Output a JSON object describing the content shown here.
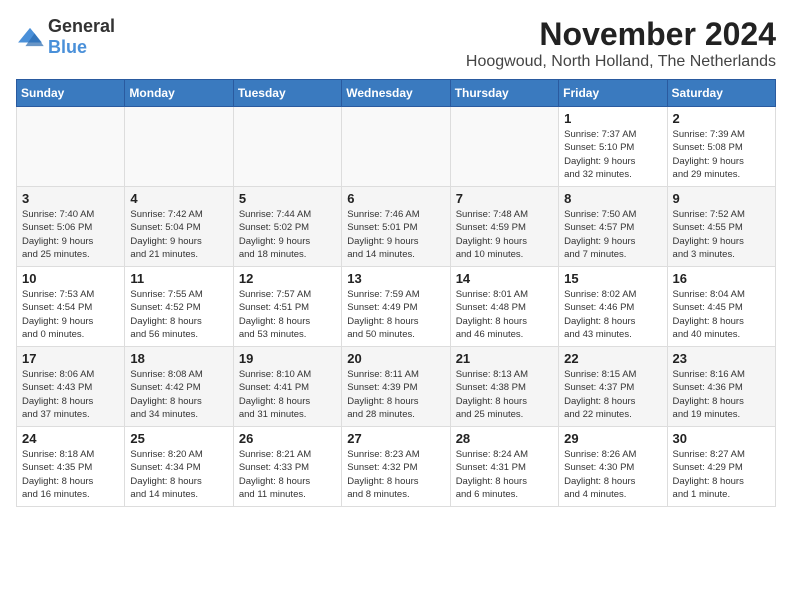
{
  "logo": {
    "general": "General",
    "blue": "Blue"
  },
  "title": "November 2024",
  "subtitle": "Hoogwoud, North Holland, The Netherlands",
  "days_header": [
    "Sunday",
    "Monday",
    "Tuesday",
    "Wednesday",
    "Thursday",
    "Friday",
    "Saturday"
  ],
  "weeks": [
    [
      {
        "day": "",
        "info": ""
      },
      {
        "day": "",
        "info": ""
      },
      {
        "day": "",
        "info": ""
      },
      {
        "day": "",
        "info": ""
      },
      {
        "day": "",
        "info": ""
      },
      {
        "day": "1",
        "info": "Sunrise: 7:37 AM\nSunset: 5:10 PM\nDaylight: 9 hours\nand 32 minutes."
      },
      {
        "day": "2",
        "info": "Sunrise: 7:39 AM\nSunset: 5:08 PM\nDaylight: 9 hours\nand 29 minutes."
      }
    ],
    [
      {
        "day": "3",
        "info": "Sunrise: 7:40 AM\nSunset: 5:06 PM\nDaylight: 9 hours\nand 25 minutes."
      },
      {
        "day": "4",
        "info": "Sunrise: 7:42 AM\nSunset: 5:04 PM\nDaylight: 9 hours\nand 21 minutes."
      },
      {
        "day": "5",
        "info": "Sunrise: 7:44 AM\nSunset: 5:02 PM\nDaylight: 9 hours\nand 18 minutes."
      },
      {
        "day": "6",
        "info": "Sunrise: 7:46 AM\nSunset: 5:01 PM\nDaylight: 9 hours\nand 14 minutes."
      },
      {
        "day": "7",
        "info": "Sunrise: 7:48 AM\nSunset: 4:59 PM\nDaylight: 9 hours\nand 10 minutes."
      },
      {
        "day": "8",
        "info": "Sunrise: 7:50 AM\nSunset: 4:57 PM\nDaylight: 9 hours\nand 7 minutes."
      },
      {
        "day": "9",
        "info": "Sunrise: 7:52 AM\nSunset: 4:55 PM\nDaylight: 9 hours\nand 3 minutes."
      }
    ],
    [
      {
        "day": "10",
        "info": "Sunrise: 7:53 AM\nSunset: 4:54 PM\nDaylight: 9 hours\nand 0 minutes."
      },
      {
        "day": "11",
        "info": "Sunrise: 7:55 AM\nSunset: 4:52 PM\nDaylight: 8 hours\nand 56 minutes."
      },
      {
        "day": "12",
        "info": "Sunrise: 7:57 AM\nSunset: 4:51 PM\nDaylight: 8 hours\nand 53 minutes."
      },
      {
        "day": "13",
        "info": "Sunrise: 7:59 AM\nSunset: 4:49 PM\nDaylight: 8 hours\nand 50 minutes."
      },
      {
        "day": "14",
        "info": "Sunrise: 8:01 AM\nSunset: 4:48 PM\nDaylight: 8 hours\nand 46 minutes."
      },
      {
        "day": "15",
        "info": "Sunrise: 8:02 AM\nSunset: 4:46 PM\nDaylight: 8 hours\nand 43 minutes."
      },
      {
        "day": "16",
        "info": "Sunrise: 8:04 AM\nSunset: 4:45 PM\nDaylight: 8 hours\nand 40 minutes."
      }
    ],
    [
      {
        "day": "17",
        "info": "Sunrise: 8:06 AM\nSunset: 4:43 PM\nDaylight: 8 hours\nand 37 minutes."
      },
      {
        "day": "18",
        "info": "Sunrise: 8:08 AM\nSunset: 4:42 PM\nDaylight: 8 hours\nand 34 minutes."
      },
      {
        "day": "19",
        "info": "Sunrise: 8:10 AM\nSunset: 4:41 PM\nDaylight: 8 hours\nand 31 minutes."
      },
      {
        "day": "20",
        "info": "Sunrise: 8:11 AM\nSunset: 4:39 PM\nDaylight: 8 hours\nand 28 minutes."
      },
      {
        "day": "21",
        "info": "Sunrise: 8:13 AM\nSunset: 4:38 PM\nDaylight: 8 hours\nand 25 minutes."
      },
      {
        "day": "22",
        "info": "Sunrise: 8:15 AM\nSunset: 4:37 PM\nDaylight: 8 hours\nand 22 minutes."
      },
      {
        "day": "23",
        "info": "Sunrise: 8:16 AM\nSunset: 4:36 PM\nDaylight: 8 hours\nand 19 minutes."
      }
    ],
    [
      {
        "day": "24",
        "info": "Sunrise: 8:18 AM\nSunset: 4:35 PM\nDaylight: 8 hours\nand 16 minutes."
      },
      {
        "day": "25",
        "info": "Sunrise: 8:20 AM\nSunset: 4:34 PM\nDaylight: 8 hours\nand 14 minutes."
      },
      {
        "day": "26",
        "info": "Sunrise: 8:21 AM\nSunset: 4:33 PM\nDaylight: 8 hours\nand 11 minutes."
      },
      {
        "day": "27",
        "info": "Sunrise: 8:23 AM\nSunset: 4:32 PM\nDaylight: 8 hours\nand 8 minutes."
      },
      {
        "day": "28",
        "info": "Sunrise: 8:24 AM\nSunset: 4:31 PM\nDaylight: 8 hours\nand 6 minutes."
      },
      {
        "day": "29",
        "info": "Sunrise: 8:26 AM\nSunset: 4:30 PM\nDaylight: 8 hours\nand 4 minutes."
      },
      {
        "day": "30",
        "info": "Sunrise: 8:27 AM\nSunset: 4:29 PM\nDaylight: 8 hours\nand 1 minute."
      }
    ]
  ]
}
